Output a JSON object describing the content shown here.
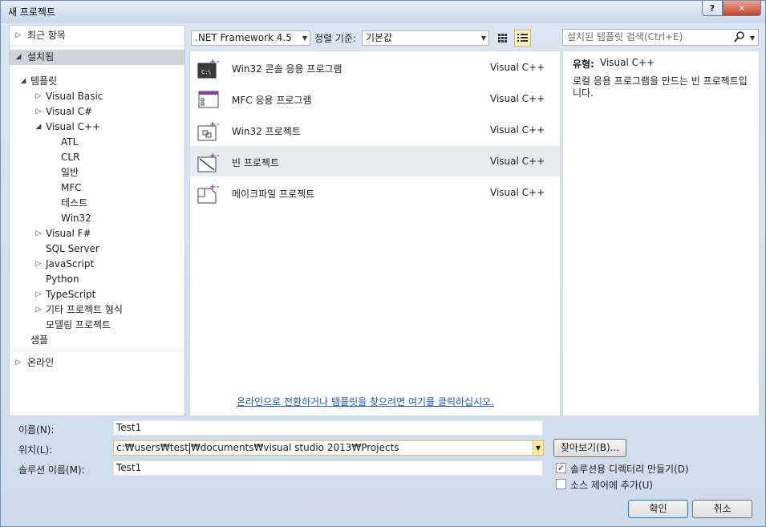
{
  "window": {
    "title": "새 프로젝트",
    "help": "?",
    "close": "✕"
  },
  "tree": {
    "recent": "최근 항목",
    "installed": "설치됨",
    "templates": "템플릿",
    "items": [
      {
        "label": "Visual Basic",
        "expander": "▷"
      },
      {
        "label": "Visual C#",
        "expander": "▷"
      },
      {
        "label": "Visual C++",
        "expander": "◢"
      }
    ],
    "cpp_children": [
      "ATL",
      "CLR",
      "일반",
      "MFC",
      "테스트",
      "Win32"
    ],
    "more": [
      {
        "label": "Visual F#",
        "expander": "▷"
      },
      {
        "label": "SQL Server",
        "expander": ""
      },
      {
        "label": "JavaScript",
        "expander": "▷"
      },
      {
        "label": "Python",
        "expander": ""
      },
      {
        "label": "TypeScript",
        "expander": "▷"
      },
      {
        "label": "기타 프로젝트 형식",
        "expander": "▷"
      },
      {
        "label": "모델링 프로젝트",
        "expander": ""
      }
    ],
    "samples": "샘플",
    "online": "온라인"
  },
  "toolbar": {
    "framework": ".NET Framework 4.5",
    "sort_label": "정렬 기준:",
    "sort_value": "기본값",
    "search_placeholder": "설치된 템플릿 검색(Ctrl+E)"
  },
  "templates": [
    {
      "name": "Win32 콘솔 응용 프로그램",
      "lang": "Visual C++"
    },
    {
      "name": "MFC 응용 프로그램",
      "lang": "Visual C++"
    },
    {
      "name": "Win32 프로젝트",
      "lang": "Visual C++"
    },
    {
      "name": "빈 프로젝트",
      "lang": "Visual C++"
    },
    {
      "name": "메이크파일 프로젝트",
      "lang": "Visual C++"
    }
  ],
  "online_link": "온라인으로 전환하거나 템플릿을 찾으려면 여기를 클릭하십시오.",
  "details": {
    "type_label": "유형:",
    "type_value": "Visual C++",
    "description": "로컬 응용 프로그램을 만드는 빈 프로젝트입니다."
  },
  "form": {
    "name_label": "이름(N):",
    "name_value": "Test1",
    "location_label": "위치(L):",
    "location_before_caret": "c:₩users₩test",
    "location_after_caret": "₩documents₩visual studio 2013₩Projects",
    "solution_label": "솔루션 이름(M):",
    "solution_value": "Test1",
    "browse": "찾아보기(B)...",
    "create_dir_label": "솔루션용 디렉터리 만들기(D)",
    "create_dir_checked": true,
    "source_control_label": "소스 제어에 추가(U)",
    "source_control_checked": false,
    "ok": "확인",
    "cancel": "취소"
  }
}
